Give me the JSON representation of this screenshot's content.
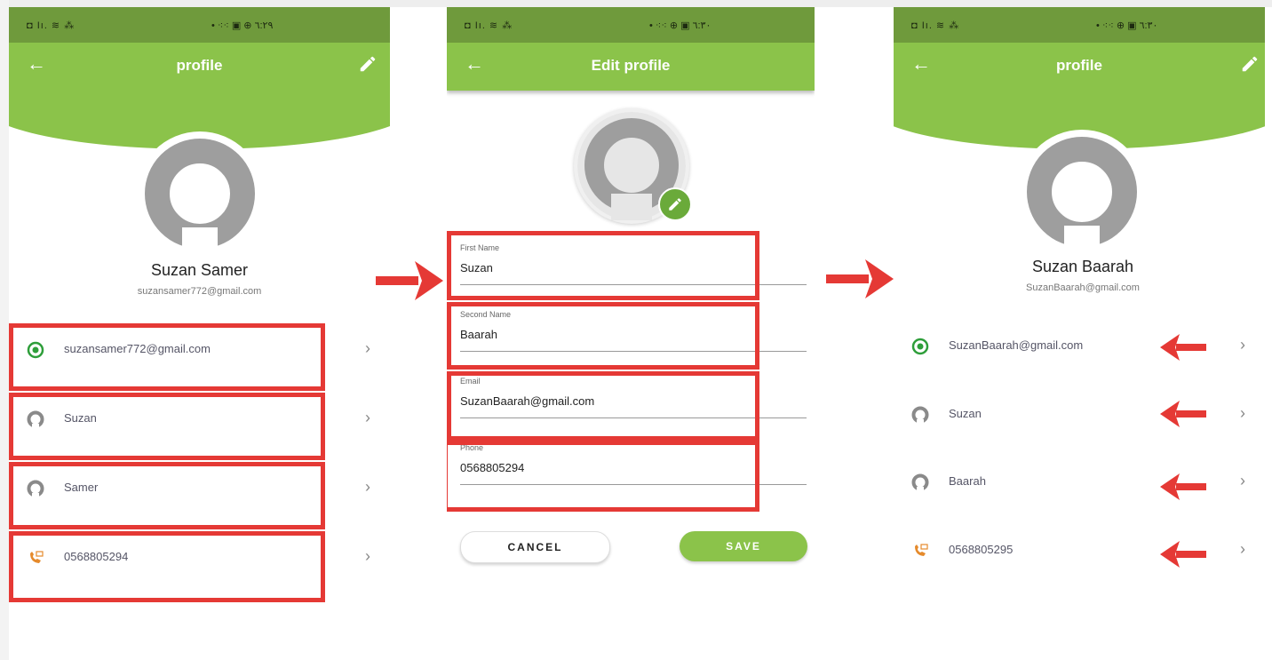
{
  "colors": {
    "primary": "#8bc34a",
    "statusbar": "#6f9a3c",
    "annotation_red": "#e53935"
  },
  "screen1": {
    "status_left": "◘ Iı. ≋ ⁂",
    "status_right": "• ⁖⁖ ▣ ⊕ ٦:٢٩",
    "title": "profile",
    "name": "Suzan Samer",
    "email": "suzansamer772@gmail.com",
    "rows": [
      {
        "icon": "whatsapp-icon",
        "label": "suzansamer772@gmail.com"
      },
      {
        "icon": "person-icon",
        "label": "Suzan"
      },
      {
        "icon": "person-icon",
        "label": "Samer"
      },
      {
        "icon": "phone-icon",
        "label": "0568805294"
      }
    ]
  },
  "screen2": {
    "status_left": "◘ Iı. ≋ ⁂",
    "status_right": "• ⁖⁖ ⊕ ▣ ٦:٣٠",
    "title": "Edit profile",
    "fields": [
      {
        "label": "First Name",
        "value": "Suzan"
      },
      {
        "label": "Second Name",
        "value": "Baarah"
      },
      {
        "label": "Email",
        "value": "SuzanBaarah@gmail.com"
      },
      {
        "label": "Phone",
        "value": "0568805294"
      }
    ],
    "cancel_label": "CANCEL",
    "save_label": "SAVE"
  },
  "screen3": {
    "status_left": "◘ Iı. ≋ ⁂",
    "status_right": "• ⁖⁖ ⊕ ▣ ٦:٣٠",
    "title": "profile",
    "name": "Suzan Baarah",
    "email": "SuzanBaarah@gmail.com",
    "rows": [
      {
        "icon": "whatsapp-icon",
        "label": "SuzanBaarah@gmail.com"
      },
      {
        "icon": "person-icon",
        "label": "Suzan"
      },
      {
        "icon": "person-icon",
        "label": "Baarah"
      },
      {
        "icon": "phone-icon",
        "label": "0568805295"
      }
    ]
  }
}
